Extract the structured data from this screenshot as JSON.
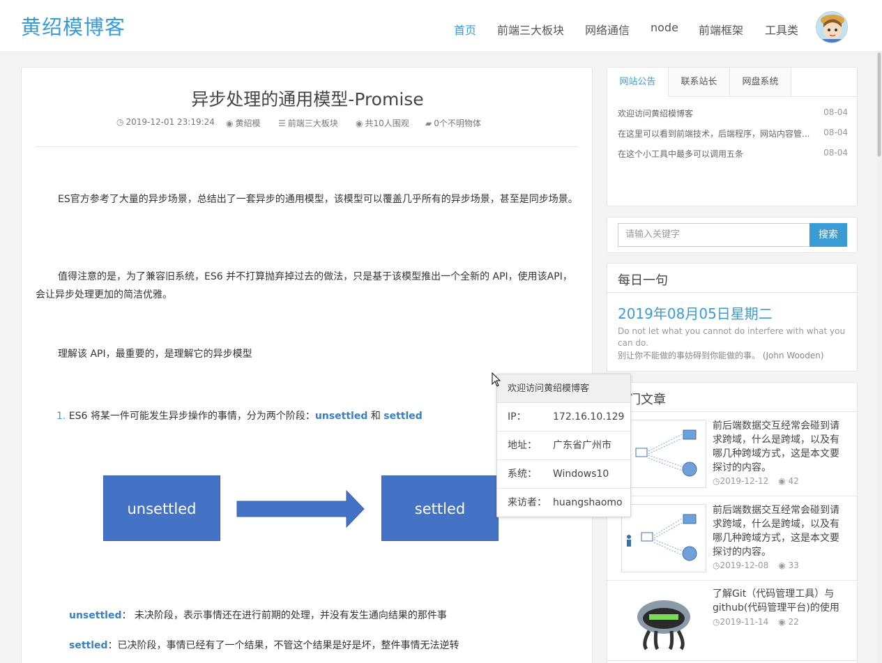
{
  "header": {
    "logo": "黄绍模博客",
    "nav": [
      "首页",
      "前端三大板块",
      "网络通信",
      "node",
      "前端框架",
      "工具类"
    ]
  },
  "article": {
    "title": "异步处理的通用模型-Promise",
    "meta": {
      "date": "2019-12-01 23:19:24",
      "author": "黄绍模",
      "category": "前端三大板块",
      "views": "共10人围观",
      "comments": "0个不明物体"
    },
    "paragraphs": [
      "ES官方参考了大量的异步场景，总结出了一套异步的通用模型，该模型可以覆盖几乎所有的异步场景，甚至是同步场景。",
      "值得注意的是，为了兼容旧系统，ES6 并不打算抛弃掉过去的做法，只是基于该模型推出一个全新的 API，使用该API，会让异步处理更加的简洁优雅。",
      "理解该 API，最重要的，是理解它的异步模型"
    ],
    "list_num": "1.",
    "list_text": "ES6 将某一件可能发生异步操作的事情，分为两个阶段：",
    "term1": "unsettled",
    "and": "和",
    "term2": "settled",
    "diagram": {
      "left": "unsettled",
      "right": "settled"
    },
    "def1_term": "unsettled",
    "def1_text": "： 未决阶段，表示事情还在进行前期的处理，并没有发生通向结果的那件事",
    "def2_term": "settled",
    "def2_text": "：已决阶段，事情已经有了一个结果，不管这个结果是好是坏，整件事情无法逆转"
  },
  "notice": {
    "tabs": [
      "网站公告",
      "联系站长",
      "网盘系统"
    ],
    "items": [
      {
        "text": "欢迎访问黄绍模博客",
        "date": "08-04"
      },
      {
        "text": "在这里可以看到前端技术，后端程序，网站内容管...",
        "date": "08-04"
      },
      {
        "text": "在这个小工具中最多可以调用五条",
        "date": "08-04"
      }
    ]
  },
  "search": {
    "placeholder": "请输入关键字",
    "button": "搜索"
  },
  "daily": {
    "title": "每日一句",
    "date": "2019年08月05日星期二",
    "en": "Do not let what you cannot do interfere with what you can do.",
    "cn": "别让你不能做的事妨碍到你能做的事。 (John Wooden)"
  },
  "hot": {
    "title": "门文章",
    "items": [
      {
        "text": "前后端数据交互经常会碰到请求跨域，什么是跨域，以及有哪几种跨域方式，这是本文要探讨的内容。",
        "date": "2019-12-12",
        "views": "42"
      },
      {
        "text": "前后端数据交互经常会碰到请求跨域，什么是跨域，以及有哪几种跨域方式，这是本文要探讨的内容。",
        "date": "2019-12-08",
        "views": "33"
      },
      {
        "text": "了解Git（代码管理工具）与github(代码管理平台)的使用",
        "date": "2019-11-14",
        "views": "22"
      }
    ]
  },
  "popup": {
    "title": "欢迎访问黄绍模博客",
    "rows": [
      {
        "k": "IP：",
        "v": "172.16.10.129"
      },
      {
        "k": "地址：",
        "v": "广东省广州市"
      },
      {
        "k": "系统：",
        "v": "Windows10"
      },
      {
        "k": "来访者：",
        "v": "huangshaomo"
      }
    ]
  },
  "colors": {
    "accent": "#3a9bd5",
    "box": "#4472c4"
  }
}
